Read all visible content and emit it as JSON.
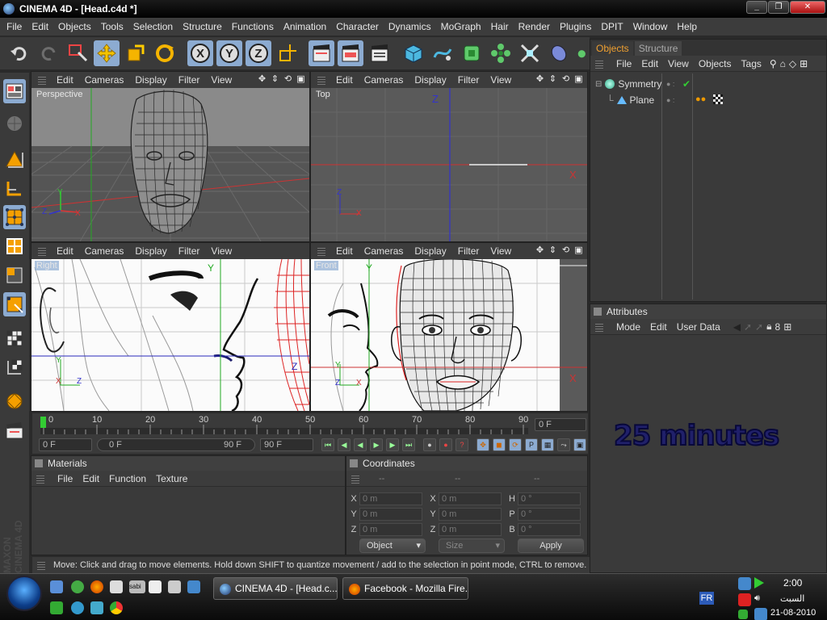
{
  "window": {
    "title": "CINEMA 4D - [Head.c4d *]",
    "minimize": "_",
    "restore": "❐",
    "close": "✕"
  },
  "menubar": [
    "File",
    "Edit",
    "Objects",
    "Tools",
    "Selection",
    "Structure",
    "Functions",
    "Animation",
    "Character",
    "Dynamics",
    "MoGraph",
    "Hair",
    "Render",
    "Plugins",
    "DPIT",
    "Window",
    "Help"
  ],
  "toolbar": {
    "icons": [
      "undo-icon",
      "redo-icon",
      "live-selection-icon",
      "move-icon",
      "scale-icon",
      "rotate-icon",
      "x-axis-icon",
      "y-axis-icon",
      "z-axis-icon",
      "world-coordinates-icon",
      "render-view-icon",
      "render-picture-viewer-icon",
      "render-settings-icon",
      "cube-icon",
      "spline-pen-icon",
      "nurbs-icon",
      "array-icon",
      "deformer-icon",
      "environment-icon",
      "camera-icon"
    ],
    "axis_labels": [
      "X",
      "Y",
      "Z"
    ]
  },
  "viewports": [
    {
      "name": "Perspective",
      "menu": [
        "Edit",
        "Cameras",
        "Display",
        "Filter",
        "View"
      ]
    },
    {
      "name": "Top",
      "menu": [
        "Edit",
        "Cameras",
        "Display",
        "Filter",
        "View"
      ]
    },
    {
      "name": "Right",
      "menu": [
        "Edit",
        "Cameras",
        "Display",
        "Filter",
        "View"
      ]
    },
    {
      "name": "Front",
      "menu": [
        "Edit",
        "Cameras",
        "Display",
        "Filter",
        "View"
      ]
    }
  ],
  "axes": {
    "x": "X",
    "y": "Y",
    "z": "Z"
  },
  "timeline": {
    "ticks": [
      "0",
      "10",
      "20",
      "30",
      "40",
      "50",
      "60",
      "70",
      "80",
      "90"
    ],
    "current": "0 F"
  },
  "playback": {
    "start": "0 F",
    "range_start": "0 F",
    "range_end": "90 F",
    "end": "90 F"
  },
  "materials": {
    "title": "Materials",
    "menu": [
      "File",
      "Edit",
      "Function",
      "Texture"
    ]
  },
  "coordinates": {
    "title": "Coordinates",
    "col_placeholders": [
      "--",
      "--",
      "--"
    ],
    "rows": [
      {
        "a": "X",
        "av": "0 m",
        "b": "X",
        "bv": "0 m",
        "c": "H",
        "cv": "0 °"
      },
      {
        "a": "Y",
        "av": "0 m",
        "b": "Y",
        "bv": "0 m",
        "c": "P",
        "cv": "0 °"
      },
      {
        "a": "Z",
        "av": "0 m",
        "b": "Z",
        "bv": "0 m",
        "c": "B",
        "cv": "0 °"
      }
    ],
    "mode": "Object",
    "size_mode": "Size",
    "apply": "Apply"
  },
  "objects_panel": {
    "tabs": [
      "Objects",
      "Structure"
    ],
    "menu": [
      "File",
      "Edit",
      "View",
      "Objects",
      "Tags"
    ],
    "items": [
      "Symmetry",
      "Plane"
    ]
  },
  "attributes": {
    "title": "Attributes",
    "menu": [
      "Mode",
      "Edit",
      "User Data"
    ]
  },
  "overlay_text": "25 minutes",
  "status": "Move: Click and drag to move elements. Hold down SHIFT to quantize movement / add to the selection in point mode, CTRL to remove.",
  "branding": "MAXON CINEMA 4D",
  "taskbar": {
    "tasks": [
      "CINEMA 4D - [Head.c...",
      "Facebook - Mozilla Fire..."
    ],
    "language": "FR",
    "time": "2:00",
    "day": "السبت",
    "date": "21-08-2010",
    "quick_label": "sabi"
  }
}
